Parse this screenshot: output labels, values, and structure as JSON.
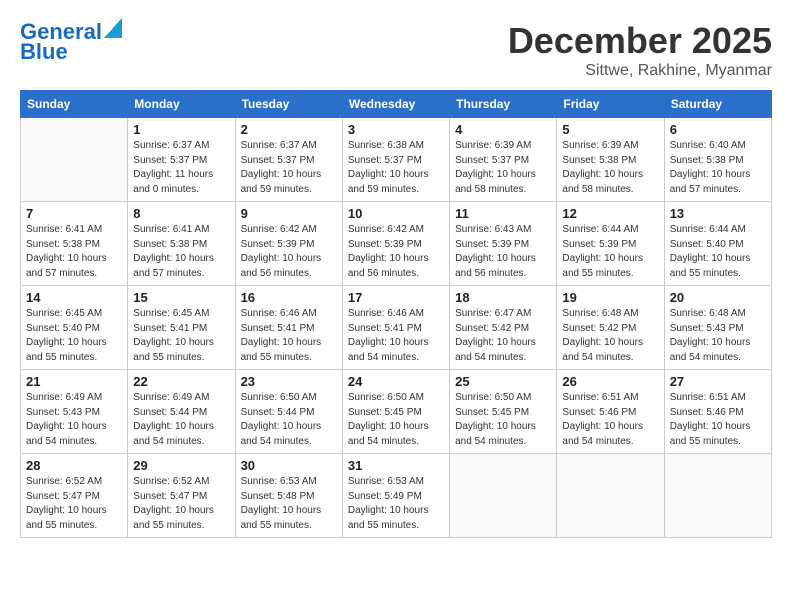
{
  "header": {
    "logo_line1": "General",
    "logo_line2": "Blue",
    "month_title": "December 2025",
    "location": "Sittwe, Rakhine, Myanmar"
  },
  "weekdays": [
    "Sunday",
    "Monday",
    "Tuesday",
    "Wednesday",
    "Thursday",
    "Friday",
    "Saturday"
  ],
  "weeks": [
    [
      {
        "num": "",
        "info": ""
      },
      {
        "num": "1",
        "info": "Sunrise: 6:37 AM\nSunset: 5:37 PM\nDaylight: 11 hours\nand 0 minutes."
      },
      {
        "num": "2",
        "info": "Sunrise: 6:37 AM\nSunset: 5:37 PM\nDaylight: 10 hours\nand 59 minutes."
      },
      {
        "num": "3",
        "info": "Sunrise: 6:38 AM\nSunset: 5:37 PM\nDaylight: 10 hours\nand 59 minutes."
      },
      {
        "num": "4",
        "info": "Sunrise: 6:39 AM\nSunset: 5:37 PM\nDaylight: 10 hours\nand 58 minutes."
      },
      {
        "num": "5",
        "info": "Sunrise: 6:39 AM\nSunset: 5:38 PM\nDaylight: 10 hours\nand 58 minutes."
      },
      {
        "num": "6",
        "info": "Sunrise: 6:40 AM\nSunset: 5:38 PM\nDaylight: 10 hours\nand 57 minutes."
      }
    ],
    [
      {
        "num": "7",
        "info": "Sunrise: 6:41 AM\nSunset: 5:38 PM\nDaylight: 10 hours\nand 57 minutes."
      },
      {
        "num": "8",
        "info": "Sunrise: 6:41 AM\nSunset: 5:38 PM\nDaylight: 10 hours\nand 57 minutes."
      },
      {
        "num": "9",
        "info": "Sunrise: 6:42 AM\nSunset: 5:39 PM\nDaylight: 10 hours\nand 56 minutes."
      },
      {
        "num": "10",
        "info": "Sunrise: 6:42 AM\nSunset: 5:39 PM\nDaylight: 10 hours\nand 56 minutes."
      },
      {
        "num": "11",
        "info": "Sunrise: 6:43 AM\nSunset: 5:39 PM\nDaylight: 10 hours\nand 56 minutes."
      },
      {
        "num": "12",
        "info": "Sunrise: 6:44 AM\nSunset: 5:39 PM\nDaylight: 10 hours\nand 55 minutes."
      },
      {
        "num": "13",
        "info": "Sunrise: 6:44 AM\nSunset: 5:40 PM\nDaylight: 10 hours\nand 55 minutes."
      }
    ],
    [
      {
        "num": "14",
        "info": "Sunrise: 6:45 AM\nSunset: 5:40 PM\nDaylight: 10 hours\nand 55 minutes."
      },
      {
        "num": "15",
        "info": "Sunrise: 6:45 AM\nSunset: 5:41 PM\nDaylight: 10 hours\nand 55 minutes."
      },
      {
        "num": "16",
        "info": "Sunrise: 6:46 AM\nSunset: 5:41 PM\nDaylight: 10 hours\nand 55 minutes."
      },
      {
        "num": "17",
        "info": "Sunrise: 6:46 AM\nSunset: 5:41 PM\nDaylight: 10 hours\nand 54 minutes."
      },
      {
        "num": "18",
        "info": "Sunrise: 6:47 AM\nSunset: 5:42 PM\nDaylight: 10 hours\nand 54 minutes."
      },
      {
        "num": "19",
        "info": "Sunrise: 6:48 AM\nSunset: 5:42 PM\nDaylight: 10 hours\nand 54 minutes."
      },
      {
        "num": "20",
        "info": "Sunrise: 6:48 AM\nSunset: 5:43 PM\nDaylight: 10 hours\nand 54 minutes."
      }
    ],
    [
      {
        "num": "21",
        "info": "Sunrise: 6:49 AM\nSunset: 5:43 PM\nDaylight: 10 hours\nand 54 minutes."
      },
      {
        "num": "22",
        "info": "Sunrise: 6:49 AM\nSunset: 5:44 PM\nDaylight: 10 hours\nand 54 minutes."
      },
      {
        "num": "23",
        "info": "Sunrise: 6:50 AM\nSunset: 5:44 PM\nDaylight: 10 hours\nand 54 minutes."
      },
      {
        "num": "24",
        "info": "Sunrise: 6:50 AM\nSunset: 5:45 PM\nDaylight: 10 hours\nand 54 minutes."
      },
      {
        "num": "25",
        "info": "Sunrise: 6:50 AM\nSunset: 5:45 PM\nDaylight: 10 hours\nand 54 minutes."
      },
      {
        "num": "26",
        "info": "Sunrise: 6:51 AM\nSunset: 5:46 PM\nDaylight: 10 hours\nand 54 minutes."
      },
      {
        "num": "27",
        "info": "Sunrise: 6:51 AM\nSunset: 5:46 PM\nDaylight: 10 hours\nand 55 minutes."
      }
    ],
    [
      {
        "num": "28",
        "info": "Sunrise: 6:52 AM\nSunset: 5:47 PM\nDaylight: 10 hours\nand 55 minutes."
      },
      {
        "num": "29",
        "info": "Sunrise: 6:52 AM\nSunset: 5:47 PM\nDaylight: 10 hours\nand 55 minutes."
      },
      {
        "num": "30",
        "info": "Sunrise: 6:53 AM\nSunset: 5:48 PM\nDaylight: 10 hours\nand 55 minutes."
      },
      {
        "num": "31",
        "info": "Sunrise: 6:53 AM\nSunset: 5:49 PM\nDaylight: 10 hours\nand 55 minutes."
      },
      {
        "num": "",
        "info": ""
      },
      {
        "num": "",
        "info": ""
      },
      {
        "num": "",
        "info": ""
      }
    ]
  ]
}
